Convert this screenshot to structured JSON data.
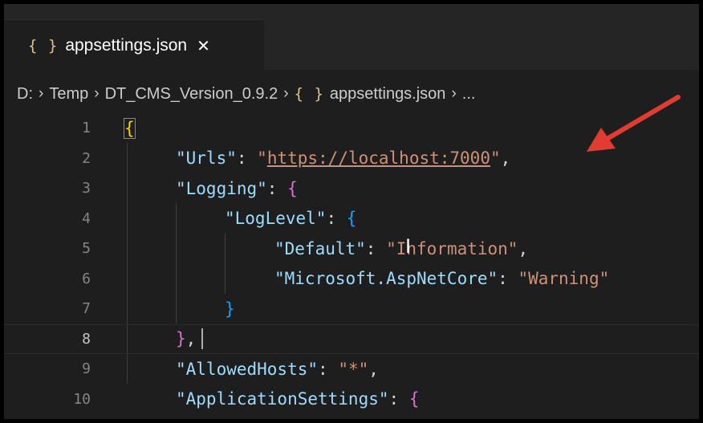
{
  "tab": {
    "icon": "json-braces-icon",
    "icon_glyph": "{ }",
    "name": "appsettings.json",
    "close_glyph": "✕"
  },
  "breadcrumb": {
    "drive": "D:",
    "folder1": "Temp",
    "folder2": "DT_CMS_Version_0.9.2",
    "file": "appsettings.json",
    "more": "...",
    "separator": "›"
  },
  "editor": {
    "active_line": 8,
    "lines": [
      {
        "n": "1"
      },
      {
        "n": "2"
      },
      {
        "n": "3"
      },
      {
        "n": "4"
      },
      {
        "n": "5"
      },
      {
        "n": "6"
      },
      {
        "n": "7"
      },
      {
        "n": "8"
      },
      {
        "n": "9"
      },
      {
        "n": "10"
      }
    ],
    "tokens": {
      "l1_open": "{",
      "l2_key": "\"Urls\"",
      "l2_colon": ": ",
      "l2_q1": "\"",
      "l2_url": "https://localhost:7000",
      "l2_q2": "\"",
      "l2_comma": ",",
      "l3_key": "\"Logging\"",
      "l3_colon": ": ",
      "l3_open": "{",
      "l4_key": "\"LogLevel\"",
      "l4_colon": ": ",
      "l4_open": "{",
      "l5_key": "\"Default\"",
      "l5_colon": ": ",
      "l5_val": "\"Information\"",
      "l5_comma": ",",
      "l6_key": "\"Microsoft.AspNetCore\"",
      "l6_colon": ": ",
      "l6_val": "\"Warning\"",
      "l7_close": "}",
      "l8_close": "}",
      "l8_comma": ",",
      "l9_key": "\"AllowedHosts\"",
      "l9_colon": ": ",
      "l9_val": "\"*\"",
      "l9_comma": ",",
      "l10_key": "\"ApplicationSettings\"",
      "l10_colon": ": ",
      "l10_open": "{"
    }
  },
  "colors": {
    "background": "#1e1e1e",
    "key": "#9cdcfe",
    "string": "#ce9178",
    "bracket_level1": "#ffd700",
    "bracket_level2": "#da70d6",
    "bracket_level3": "#179fff",
    "annotation_arrow": "#e03c31"
  },
  "annotation": {
    "icon": "red-arrow-icon"
  }
}
